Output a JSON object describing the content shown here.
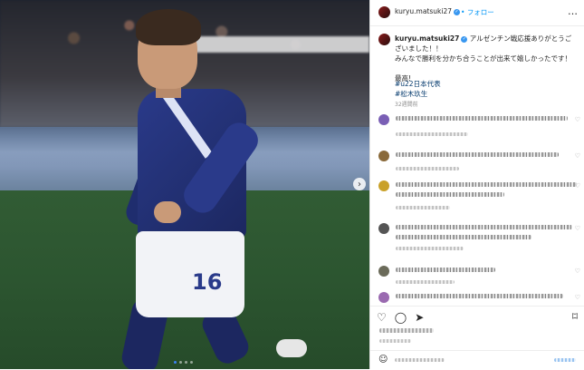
{
  "header": {
    "username": "kuryu.matsuki27",
    "follow_label": "フォロー",
    "more_icon": "more-icon"
  },
  "caption": {
    "username": "kuryu.matsuki27",
    "line1": "アルゼンチン戦応援ありがとうございました！！",
    "line2": "みんなで勝利を分かち合うことが出来て嬉しかったです！",
    "line3": "最高!",
    "hashtags": [
      "#u22日本代表",
      "#松木玖生"
    ],
    "posted_ago": "32週間前"
  },
  "photo": {
    "jersey_number": "16",
    "carousel_dots": 4,
    "active_dot": 1
  },
  "colors": {
    "link_blue": "#0095f6",
    "hashtag_blue": "#00376b",
    "verified_blue": "#3897f0"
  }
}
